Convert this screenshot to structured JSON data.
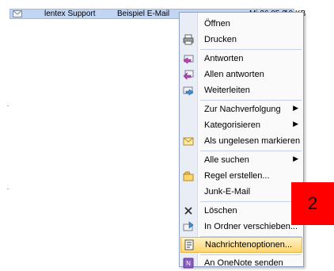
{
  "email_row": {
    "from": "lentex Support",
    "subject": "Beispiel E-Mail",
    "date": "Mi 26.05.2",
    "size": "10 KB"
  },
  "context_menu": {
    "items": [
      {
        "label": "Öffnen",
        "icon": ""
      },
      {
        "label": "Drucken",
        "icon": "printer-icon"
      },
      {
        "label": "Antworten",
        "icon": "reply-icon"
      },
      {
        "label": "Allen antworten",
        "icon": "reply-all-icon"
      },
      {
        "label": "Weiterleiten",
        "icon": "forward-icon"
      },
      {
        "label": "Zur Nachverfolgung",
        "icon": "",
        "submenu": true
      },
      {
        "label": "Kategorisieren",
        "icon": "",
        "submenu": true
      },
      {
        "label": "Als ungelesen markieren",
        "icon": "mark-unread-icon"
      },
      {
        "label": "Alle suchen",
        "icon": "",
        "submenu": true
      },
      {
        "label": "Regel erstellen...",
        "icon": "rule-icon"
      },
      {
        "label": "Junk-E-Mail",
        "icon": ""
      },
      {
        "label": "Löschen",
        "icon": "delete-icon"
      },
      {
        "label": "In Ordner verschieben...",
        "icon": "move-to-folder-icon"
      },
      {
        "label": "Nachrichtenoptionen...",
        "icon": "message-options-icon",
        "highlighted": true
      },
      {
        "label": "An OneNote senden",
        "icon": "onenote-icon"
      }
    ]
  },
  "step_badge": "2",
  "colors": {
    "selection": "#c2d5f2",
    "highlight": "#ffd56e",
    "badge": "#ff0000"
  }
}
